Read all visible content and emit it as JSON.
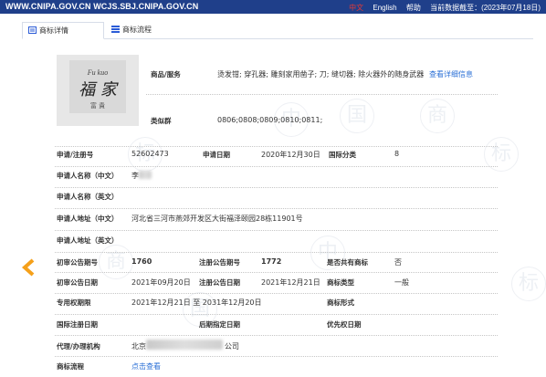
{
  "topbar": {
    "sites": "WWW.CNIPA.GOV.CN WCJS.SBJ.CNIPA.GOV.CN",
    "lang_zh": "中文",
    "lang_en": "English",
    "help": "帮助",
    "data_date": "当前数据截至：(2023年07月18日)"
  },
  "tabs": [
    {
      "label": "商标详情"
    },
    {
      "label": "商标流程"
    }
  ],
  "goods": {
    "label": "商品/服务",
    "value": "烫发钳; 穿孔器; 雕刻家用凿子; 刀; 缝切器; 除火器外的随身武器",
    "link": "查看详细信息"
  },
  "similar": {
    "label": "类似群",
    "value": "0806;0808;0809;0810;0811;"
  },
  "rows": {
    "reg_no_label": "申请/注册号",
    "reg_no": "52602473",
    "app_date_label": "申请日期",
    "app_date": "2020年12月30日",
    "intl_class_label": "国际分类",
    "intl_class": "8",
    "applicant_cn_label": "申请人名称（中文）",
    "applicant_cn": "李",
    "applicant_en_label": "申请人名称（英文）",
    "address_cn_label": "申请人地址（中文）",
    "address_cn": "河北省三河市燕郊开发区大街福泽颐园28栋11901号",
    "address_en_label": "申请人地址（英文）",
    "prelim_no_label": "初审公告期号",
    "prelim_no": "1760",
    "reg_pub_no_label": "注册公告期号",
    "reg_pub_no": "1772",
    "shared_label": "是否共有商标",
    "shared": "否",
    "prelim_date_label": "初审公告日期",
    "prelim_date": "2021年09月20日",
    "reg_pub_date_label": "注册公告日期",
    "reg_pub_date": "2021年12月21日",
    "tm_type_label": "商标类型",
    "tm_type": "一般",
    "exclusive_label": "专用权期限",
    "exclusive": "2021年12月21日 至 2031年12月20日",
    "tm_form_label": "商标形式",
    "intl_reg_date_label": "国际注册日期",
    "later_date_label": "后期指定日期",
    "priority_label": "优先权日期",
    "agent_label": "代理/办理机构",
    "agent_prefix": "北京",
    "agent_suffix": "公司",
    "process_label": "商标流程",
    "process_link": "点击查看"
  },
  "logo_text": {
    "top": "Fu  kuo",
    "main": "福 家",
    "sub": "富 貴"
  },
  "colors": {
    "topbar": "#1f3f8a",
    "link": "#2a6fd6",
    "arrow": "#f5a01a"
  }
}
